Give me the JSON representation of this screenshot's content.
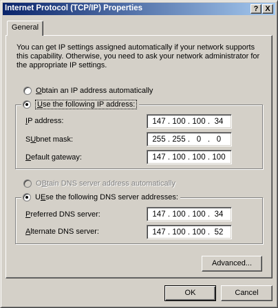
{
  "window": {
    "title": "Internet Protocol (TCP/IP) Properties",
    "help_button": "?",
    "close_button": "X"
  },
  "tabs": [
    {
      "label": "General"
    }
  ],
  "description": "You can get IP settings assigned automatically if your network supports this capability. Otherwise, you need to ask your network administrator for the appropriate IP settings.",
  "ip_mode": {
    "auto_label_first": "O",
    "auto_label_rest": "btain an IP address automatically",
    "manual_label_first": "U",
    "manual_label_rest": "se the following IP address:",
    "selected": "manual"
  },
  "ip_fields": [
    {
      "label_first": "I",
      "label_rest": "P address:",
      "octets": [
        "147",
        "100",
        "100",
        "34"
      ]
    },
    {
      "label_first": "U",
      "label_rest": "bnet mask:",
      "label_prefix": "S",
      "octets": [
        "255",
        "255",
        "0",
        "0"
      ]
    },
    {
      "label_first": "D",
      "label_rest": "efault gateway:",
      "octets": [
        "147",
        "100",
        "100",
        "100"
      ]
    }
  ],
  "dns_mode": {
    "auto_label_first": "B",
    "auto_label_prefix": "O",
    "auto_label_rest": "tain DNS server address automatically",
    "manual_label_first": "E",
    "manual_label_prefix": "U",
    "manual_label_rest": "se the following DNS server addresses:",
    "selected": "manual",
    "auto_disabled": true
  },
  "dns_fields": [
    {
      "label_first": "P",
      "label_rest": "referred DNS server:",
      "octets": [
        "147",
        "100",
        "100",
        "34"
      ]
    },
    {
      "label_first": "A",
      "label_rest": "lternate DNS server:",
      "octets": [
        "147",
        "100",
        "100",
        "52"
      ]
    }
  ],
  "buttons": {
    "advanced": "Advanced...",
    "ok": "OK",
    "cancel": "Cancel"
  }
}
